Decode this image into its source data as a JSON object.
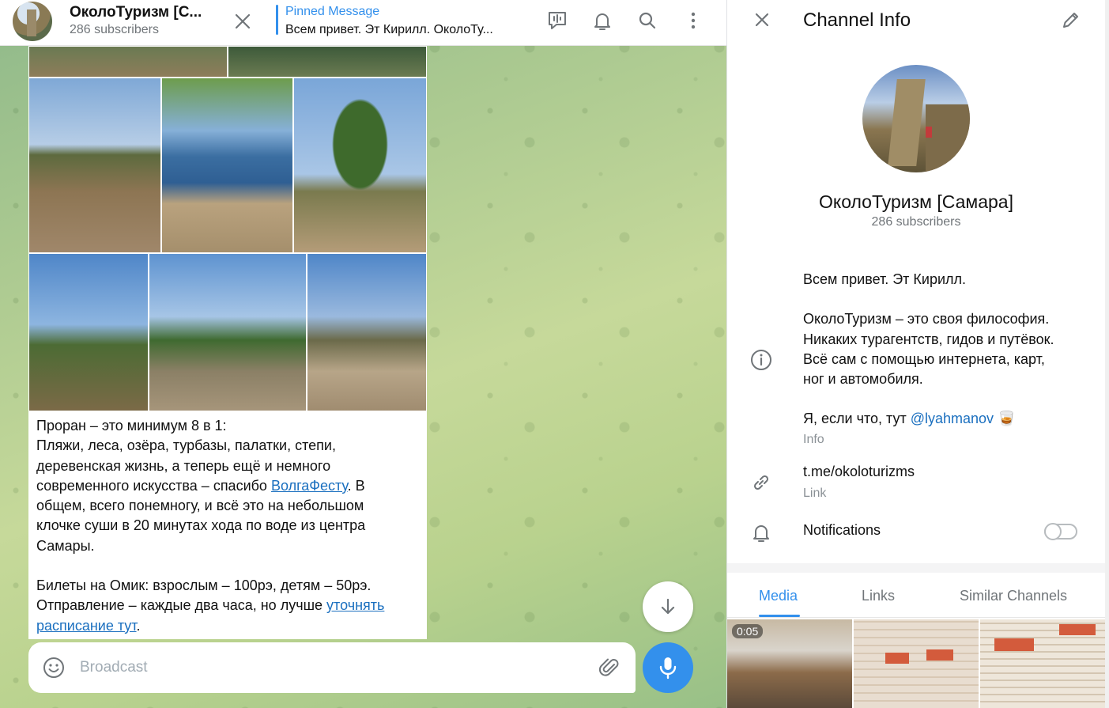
{
  "header": {
    "channel_title": "ОколоТуризм [С...",
    "subscribers": "286 subscribers",
    "pinned_label": "Pinned Message",
    "pinned_text": "Всем привет. Эт Кирилл. ОколоТу..."
  },
  "message": {
    "line1": "Проран – это минимум 8 в 1:",
    "line2": "Пляжи, леса, озёра, турбазы, палатки, степи,",
    "line3": "деревенская жизнь, а теперь ещё и немного",
    "line4_pre": "современного искусства – спасибо ",
    "line4_link": "ВолгаФесту",
    "line4_post": ". В",
    "line5": "общем, всего понемногу, и всё это на небольшом",
    "line6": "клочке суши в 20 минутах хода по воде из центра",
    "line7": "Самары.",
    "line8": "Билеты на Омик: взрослым – 100рэ, детям – 50рэ.",
    "line9_pre": "Отправление – каждые два часа, но лучше ",
    "line9_link": "уточнять",
    "line10_link": "расписание тут",
    "line10_post": "."
  },
  "composer": {
    "placeholder": "Broadcast"
  },
  "info": {
    "title": "Channel Info",
    "name": "ОколоТуризм [Самара]",
    "subscribers": "286 subscribers",
    "desc_l1": "Всем привет. Эт Кирилл.",
    "desc_l2": "ОколоТуризм – это своя философия.",
    "desc_l3": "Никаких турагентств, гидов и путёвок.",
    "desc_l4": "Всё сам с помощью интернета, карт,",
    "desc_l5": "ног и автомобиля.",
    "desc_l6_pre": "Я, если что, тут ",
    "desc_l6_link": "@lyahmanov",
    "desc_l6_emoji": "🥃",
    "info_caption": "Info",
    "link": "t.me/okoloturizms",
    "link_caption": "Link",
    "notifications": "Notifications",
    "notifications_on": false
  },
  "tabs": [
    {
      "label": "Media",
      "active": true
    },
    {
      "label": "Links",
      "active": false
    },
    {
      "label": "Similar Channels",
      "active": false
    }
  ],
  "media": {
    "video_duration": "0:05"
  },
  "colors": {
    "accent": "#3390ec",
    "link": "#1a6fbf",
    "muted": "#707579"
  }
}
